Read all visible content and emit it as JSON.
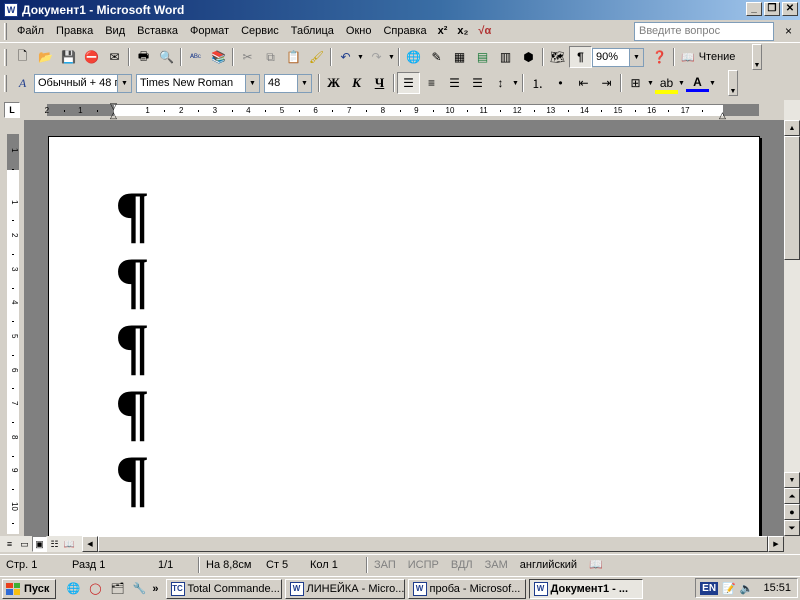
{
  "window": {
    "title": "Документ1 - Microsoft Word",
    "app_icon": "W"
  },
  "menu": {
    "items": [
      "Файл",
      "Правка",
      "Вид",
      "Вставка",
      "Формат",
      "Сервис",
      "Таблица",
      "Окно",
      "Справка"
    ],
    "superscript_label": "x²",
    "subscript_label": "x₂",
    "equation_label": "√α",
    "ask_placeholder": "Введите вопрос",
    "close_doc": "×"
  },
  "standard_toolbar": {
    "zoom": "90%",
    "read_label": "Чтение"
  },
  "formatting_toolbar": {
    "style": "Обычный + 48 г",
    "font": "Times New Roman",
    "size": "48",
    "bold": "Ж",
    "italic": "К",
    "underline": "Ч"
  },
  "ruler": {
    "corner_label": "L",
    "h_labels": [
      "2",
      "1",
      "1",
      "2",
      "3",
      "4",
      "5",
      "6",
      "7",
      "8",
      "9",
      "10",
      "11",
      "12",
      "13",
      "14",
      "15",
      "16",
      "17"
    ],
    "v_labels": [
      "1",
      "1",
      "2",
      "3",
      "4",
      "5",
      "6",
      "7",
      "8",
      "9",
      "10"
    ]
  },
  "document": {
    "paragraph_marks": [
      "¶",
      "¶",
      "¶",
      "¶",
      "¶"
    ]
  },
  "status": {
    "page": "Стр. 1",
    "section": "Разд 1",
    "pages": "1/1",
    "at": "На 8,8см",
    "line": "Ст 5",
    "col": "Кол 1",
    "rec": "ЗАП",
    "trk": "ИСПР",
    "ext": "ВДЛ",
    "ovr": "ЗАМ",
    "language": "английский"
  },
  "taskbar": {
    "start_label": "Пуск",
    "quick_launch_more": "»",
    "tasks": [
      {
        "label": "Total Commande...",
        "active": false
      },
      {
        "label": "ЛИНЕЙКА - Micro...",
        "active": false
      },
      {
        "label": "проба - Microsof...",
        "active": false
      },
      {
        "label": "Документ1 - ...",
        "active": true
      }
    ],
    "lang": "EN",
    "clock": "15:51"
  },
  "colors": {
    "titlebar_start": "#0A246A",
    "titlebar_end": "#A6CAF0",
    "chrome": "#D4D0C8",
    "doc_background": "#808080"
  }
}
